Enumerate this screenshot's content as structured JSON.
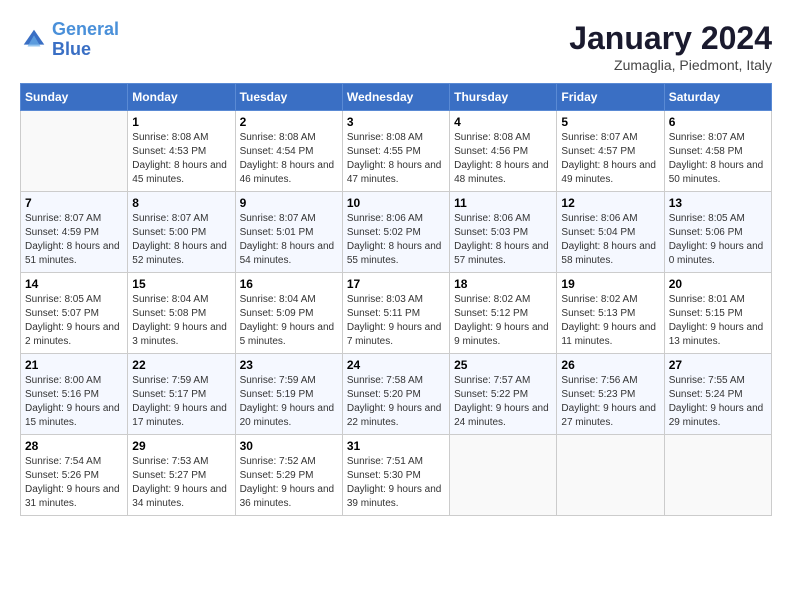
{
  "header": {
    "logo_line1": "General",
    "logo_line2": "Blue",
    "month_title": "January 2024",
    "location": "Zumaglia, Piedmont, Italy"
  },
  "weekdays": [
    "Sunday",
    "Monday",
    "Tuesday",
    "Wednesday",
    "Thursday",
    "Friday",
    "Saturday"
  ],
  "weeks": [
    [
      {
        "day": "",
        "sunrise": "",
        "sunset": "",
        "daylight": ""
      },
      {
        "day": "1",
        "sunrise": "Sunrise: 8:08 AM",
        "sunset": "Sunset: 4:53 PM",
        "daylight": "Daylight: 8 hours and 45 minutes."
      },
      {
        "day": "2",
        "sunrise": "Sunrise: 8:08 AM",
        "sunset": "Sunset: 4:54 PM",
        "daylight": "Daylight: 8 hours and 46 minutes."
      },
      {
        "day": "3",
        "sunrise": "Sunrise: 8:08 AM",
        "sunset": "Sunset: 4:55 PM",
        "daylight": "Daylight: 8 hours and 47 minutes."
      },
      {
        "day": "4",
        "sunrise": "Sunrise: 8:08 AM",
        "sunset": "Sunset: 4:56 PM",
        "daylight": "Daylight: 8 hours and 48 minutes."
      },
      {
        "day": "5",
        "sunrise": "Sunrise: 8:07 AM",
        "sunset": "Sunset: 4:57 PM",
        "daylight": "Daylight: 8 hours and 49 minutes."
      },
      {
        "day": "6",
        "sunrise": "Sunrise: 8:07 AM",
        "sunset": "Sunset: 4:58 PM",
        "daylight": "Daylight: 8 hours and 50 minutes."
      }
    ],
    [
      {
        "day": "7",
        "sunrise": "Sunrise: 8:07 AM",
        "sunset": "Sunset: 4:59 PM",
        "daylight": "Daylight: 8 hours and 51 minutes."
      },
      {
        "day": "8",
        "sunrise": "Sunrise: 8:07 AM",
        "sunset": "Sunset: 5:00 PM",
        "daylight": "Daylight: 8 hours and 52 minutes."
      },
      {
        "day": "9",
        "sunrise": "Sunrise: 8:07 AM",
        "sunset": "Sunset: 5:01 PM",
        "daylight": "Daylight: 8 hours and 54 minutes."
      },
      {
        "day": "10",
        "sunrise": "Sunrise: 8:06 AM",
        "sunset": "Sunset: 5:02 PM",
        "daylight": "Daylight: 8 hours and 55 minutes."
      },
      {
        "day": "11",
        "sunrise": "Sunrise: 8:06 AM",
        "sunset": "Sunset: 5:03 PM",
        "daylight": "Daylight: 8 hours and 57 minutes."
      },
      {
        "day": "12",
        "sunrise": "Sunrise: 8:06 AM",
        "sunset": "Sunset: 5:04 PM",
        "daylight": "Daylight: 8 hours and 58 minutes."
      },
      {
        "day": "13",
        "sunrise": "Sunrise: 8:05 AM",
        "sunset": "Sunset: 5:06 PM",
        "daylight": "Daylight: 9 hours and 0 minutes."
      }
    ],
    [
      {
        "day": "14",
        "sunrise": "Sunrise: 8:05 AM",
        "sunset": "Sunset: 5:07 PM",
        "daylight": "Daylight: 9 hours and 2 minutes."
      },
      {
        "day": "15",
        "sunrise": "Sunrise: 8:04 AM",
        "sunset": "Sunset: 5:08 PM",
        "daylight": "Daylight: 9 hours and 3 minutes."
      },
      {
        "day": "16",
        "sunrise": "Sunrise: 8:04 AM",
        "sunset": "Sunset: 5:09 PM",
        "daylight": "Daylight: 9 hours and 5 minutes."
      },
      {
        "day": "17",
        "sunrise": "Sunrise: 8:03 AM",
        "sunset": "Sunset: 5:11 PM",
        "daylight": "Daylight: 9 hours and 7 minutes."
      },
      {
        "day": "18",
        "sunrise": "Sunrise: 8:02 AM",
        "sunset": "Sunset: 5:12 PM",
        "daylight": "Daylight: 9 hours and 9 minutes."
      },
      {
        "day": "19",
        "sunrise": "Sunrise: 8:02 AM",
        "sunset": "Sunset: 5:13 PM",
        "daylight": "Daylight: 9 hours and 11 minutes."
      },
      {
        "day": "20",
        "sunrise": "Sunrise: 8:01 AM",
        "sunset": "Sunset: 5:15 PM",
        "daylight": "Daylight: 9 hours and 13 minutes."
      }
    ],
    [
      {
        "day": "21",
        "sunrise": "Sunrise: 8:00 AM",
        "sunset": "Sunset: 5:16 PM",
        "daylight": "Daylight: 9 hours and 15 minutes."
      },
      {
        "day": "22",
        "sunrise": "Sunrise: 7:59 AM",
        "sunset": "Sunset: 5:17 PM",
        "daylight": "Daylight: 9 hours and 17 minutes."
      },
      {
        "day": "23",
        "sunrise": "Sunrise: 7:59 AM",
        "sunset": "Sunset: 5:19 PM",
        "daylight": "Daylight: 9 hours and 20 minutes."
      },
      {
        "day": "24",
        "sunrise": "Sunrise: 7:58 AM",
        "sunset": "Sunset: 5:20 PM",
        "daylight": "Daylight: 9 hours and 22 minutes."
      },
      {
        "day": "25",
        "sunrise": "Sunrise: 7:57 AM",
        "sunset": "Sunset: 5:22 PM",
        "daylight": "Daylight: 9 hours and 24 minutes."
      },
      {
        "day": "26",
        "sunrise": "Sunrise: 7:56 AM",
        "sunset": "Sunset: 5:23 PM",
        "daylight": "Daylight: 9 hours and 27 minutes."
      },
      {
        "day": "27",
        "sunrise": "Sunrise: 7:55 AM",
        "sunset": "Sunset: 5:24 PM",
        "daylight": "Daylight: 9 hours and 29 minutes."
      }
    ],
    [
      {
        "day": "28",
        "sunrise": "Sunrise: 7:54 AM",
        "sunset": "Sunset: 5:26 PM",
        "daylight": "Daylight: 9 hours and 31 minutes."
      },
      {
        "day": "29",
        "sunrise": "Sunrise: 7:53 AM",
        "sunset": "Sunset: 5:27 PM",
        "daylight": "Daylight: 9 hours and 34 minutes."
      },
      {
        "day": "30",
        "sunrise": "Sunrise: 7:52 AM",
        "sunset": "Sunset: 5:29 PM",
        "daylight": "Daylight: 9 hours and 36 minutes."
      },
      {
        "day": "31",
        "sunrise": "Sunrise: 7:51 AM",
        "sunset": "Sunset: 5:30 PM",
        "daylight": "Daylight: 9 hours and 39 minutes."
      },
      {
        "day": "",
        "sunrise": "",
        "sunset": "",
        "daylight": ""
      },
      {
        "day": "",
        "sunrise": "",
        "sunset": "",
        "daylight": ""
      },
      {
        "day": "",
        "sunrise": "",
        "sunset": "",
        "daylight": ""
      }
    ]
  ]
}
